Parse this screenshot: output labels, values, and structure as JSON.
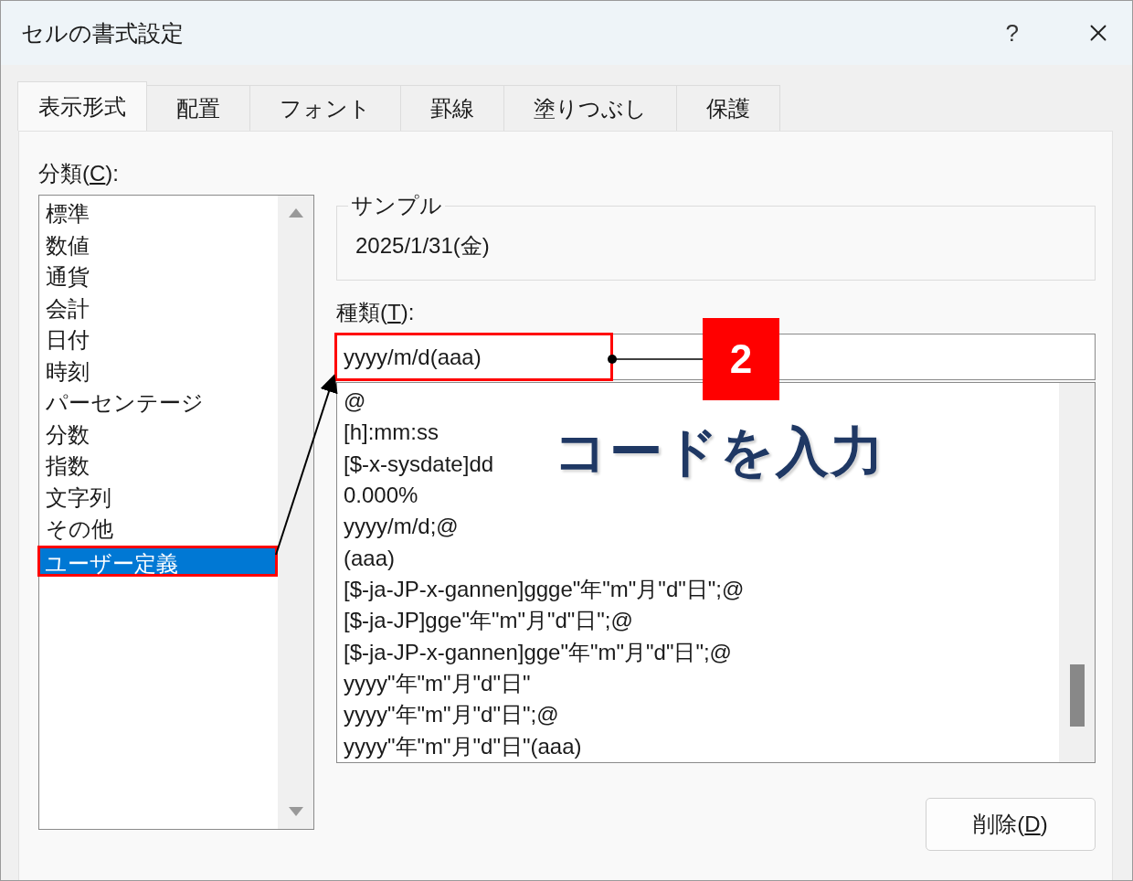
{
  "window": {
    "title": "セルの書式設定",
    "help": "?"
  },
  "tabs": [
    {
      "label": "表示形式",
      "selected": true
    },
    {
      "label": "配置",
      "selected": false
    },
    {
      "label": "フォント",
      "selected": false
    },
    {
      "label": "罫線",
      "selected": false
    },
    {
      "label": "塗りつぶし",
      "selected": false
    },
    {
      "label": "保護",
      "selected": false
    }
  ],
  "category": {
    "label": {
      "before": "分類(",
      "key": "C",
      "after": "):"
    },
    "items": [
      {
        "label": "標準",
        "selected": false,
        "highlighted": false
      },
      {
        "label": "数値",
        "selected": false,
        "highlighted": false
      },
      {
        "label": "通貨",
        "selected": false,
        "highlighted": false
      },
      {
        "label": "会計",
        "selected": false,
        "highlighted": false
      },
      {
        "label": "日付",
        "selected": false,
        "highlighted": false
      },
      {
        "label": "時刻",
        "selected": false,
        "highlighted": false
      },
      {
        "label": "パーセンテージ",
        "selected": false,
        "highlighted": false
      },
      {
        "label": "分数",
        "selected": false,
        "highlighted": false
      },
      {
        "label": "指数",
        "selected": false,
        "highlighted": false
      },
      {
        "label": "文字列",
        "selected": false,
        "highlighted": false
      },
      {
        "label": "その他",
        "selected": false,
        "highlighted": false
      },
      {
        "label": "ユーザー定義",
        "selected": true,
        "highlighted": true
      }
    ]
  },
  "sample": {
    "label": "サンプル",
    "value": "2025/1/31(金)"
  },
  "type": {
    "label": {
      "before": "種類(",
      "key": "T",
      "after": "):"
    },
    "value": "yyyy/m/d(aaa)",
    "highlighted": true,
    "items": [
      "@",
      "[h]:mm:ss",
      "[$-x-sysdate]dd",
      "0.000%",
      "yyyy/m/d;@",
      "(aaa)",
      "[$-ja-JP-x-gannen]ggge\"年\"m\"月\"d\"日\";@",
      "[$-ja-JP]gge\"年\"m\"月\"d\"日\";@",
      "[$-ja-JP-x-gannen]gge\"年\"m\"月\"d\"日\";@",
      "yyyy\"年\"m\"月\"d\"日\"",
      "yyyy\"年\"m\"月\"d\"日\";@",
      "yyyy\"年\"m\"月\"d\"日\"(aaa)"
    ]
  },
  "annotation": {
    "step": "2",
    "caption": "コードを入力"
  },
  "buttons": [
    {
      "label": {
        "before": "削除(",
        "key": "D",
        "after": ")"
      }
    }
  ]
}
